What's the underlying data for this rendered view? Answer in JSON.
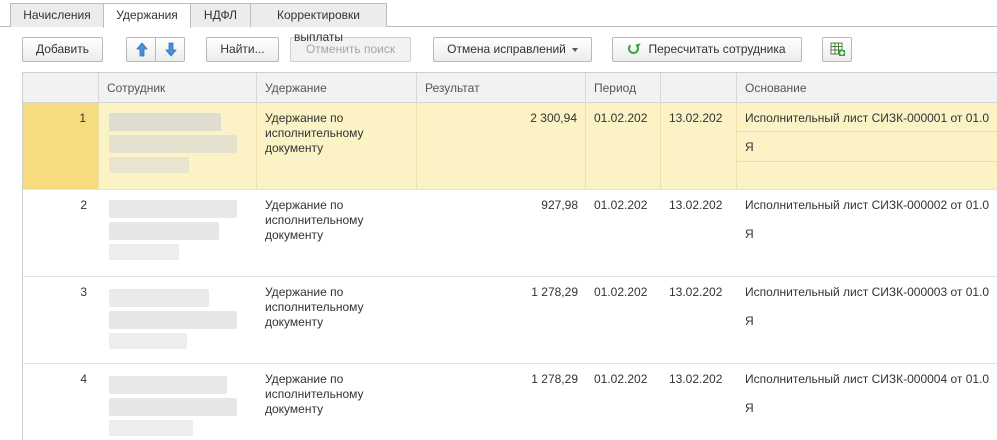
{
  "tabs": [
    {
      "label": "Начисления",
      "active": false
    },
    {
      "label": "Удержания",
      "active": true
    },
    {
      "label": "НДФЛ",
      "active": false
    },
    {
      "label": "Корректировки выплаты",
      "active": false
    }
  ],
  "toolbar": {
    "add_label": "Добавить",
    "find_label": "Найти...",
    "cancel_search_label": "Отменить поиск",
    "cancel_corrections_label": "Отмена исправлений",
    "recalc_label": "Пересчитать сотрудника"
  },
  "table": {
    "columns": {
      "employee": "Сотрудник",
      "deduction": "Удержание",
      "result": "Результат",
      "period": "Период",
      "period_end": "",
      "basis": "Основание"
    },
    "rows": [
      {
        "n": "1",
        "deduction": "Удержание по исполнительному документу",
        "result": "2 300,94",
        "start": "01.02.202",
        "end": "13.02.202",
        "basis": "Исполнительный лист СИЗК-000001 от 01.0",
        "basis2": "Я",
        "selected": true
      },
      {
        "n": "2",
        "deduction": "Удержание по исполнительному документу",
        "result": "927,98",
        "start": "01.02.202",
        "end": "13.02.202",
        "basis": "Исполнительный лист СИЗК-000002 от 01.0",
        "basis2": "Я",
        "selected": false
      },
      {
        "n": "3",
        "deduction": "Удержание по исполнительному документу",
        "result": "1 278,29",
        "start": "01.02.202",
        "end": "13.02.202",
        "basis": "Исполнительный лист СИЗК-000003 от 01.0",
        "basis2": "Я",
        "selected": false
      },
      {
        "n": "4",
        "deduction": "Удержание по исполнительному документу",
        "result": "1 278,29",
        "start": "01.02.202",
        "end": "13.02.202",
        "basis": "Исполнительный лист СИЗК-000004 от 01.0",
        "basis2": "Я",
        "selected": false
      }
    ]
  },
  "colors": {
    "selected_row": "#fbf2c6",
    "selected_num": "#f7dc7f",
    "accent_blue": "#4a90d9",
    "refresh_green": "#3aa142"
  }
}
